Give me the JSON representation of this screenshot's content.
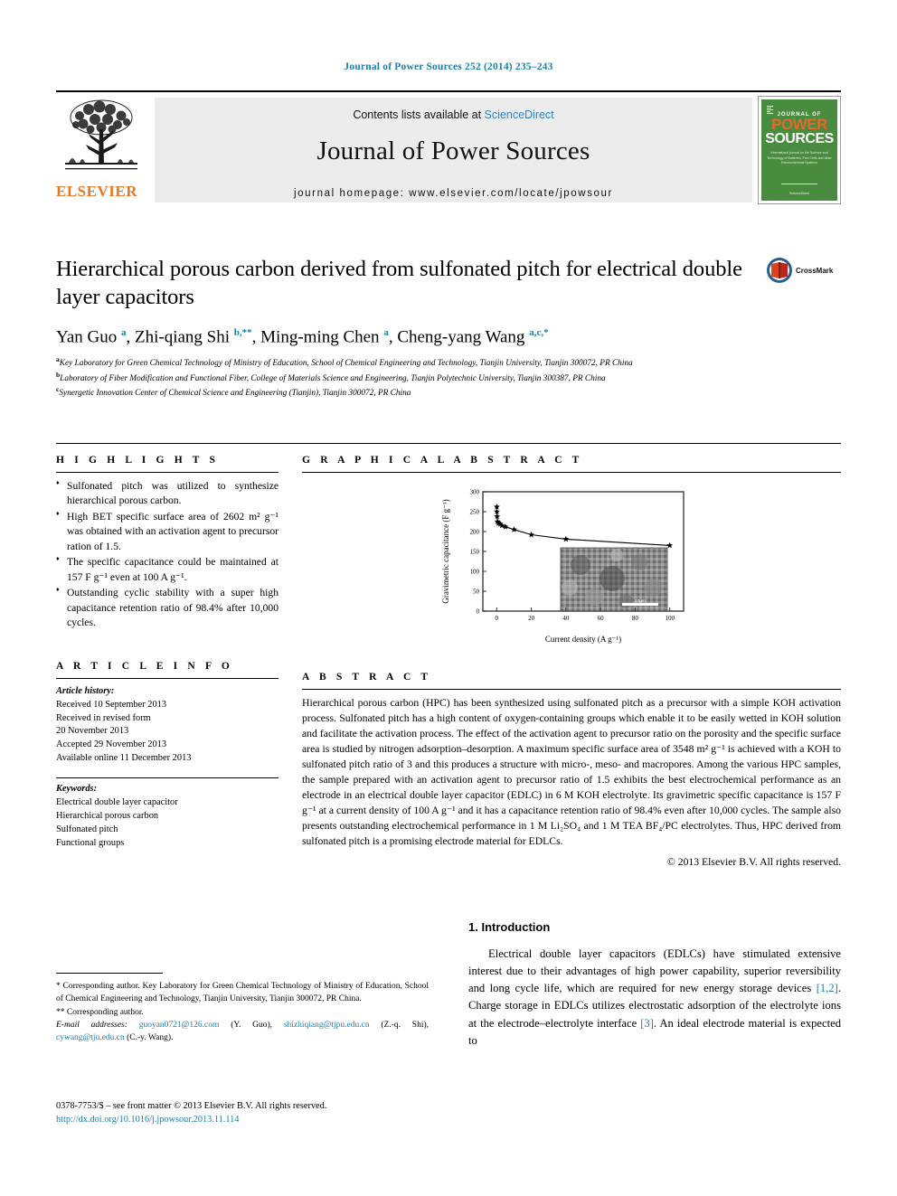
{
  "running_head": "Journal of Power Sources 252 (2014) 235–243",
  "masthead": {
    "publisher": "ELSEVIER",
    "contents_prefix": "Contents lists available at ",
    "sciencedirect": "ScienceDirect",
    "journal_title": "Journal of Power Sources",
    "homepage": "journal homepage: www.elsevier.com/locate/jpowsour",
    "cover": {
      "line1": "JOURNAL OF",
      "line2": "POWER",
      "line3": "SOURCES",
      "subtitle": "International journal on the Science and Technology of Batteries, Fuel Cells and other Electrochemical Systems",
      "footer": "ScienceDirect"
    }
  },
  "article": {
    "title": "Hierarchical porous carbon derived from sulfonated pitch for electrical double layer capacitors",
    "crossmark_label": "CrossMark",
    "authors_html": "Yan Guo <sup>a</sup>, Zhi-qiang Shi <sup>b,**</sup>, Ming-ming Chen <sup>a</sup>, Cheng-yang Wang <sup>a,c,*</sup>",
    "affiliations": [
      "Key Laboratory for Green Chemical Technology of Ministry of Education, School of Chemical Engineering and Technology, Tianjin University, Tianjin 300072, PR China",
      "Laboratory of Fiber Modification and Functional Fiber, College of Materials Science and Engineering, Tianjin Polytechnic University, Tianjin 300387, PR China",
      "Synergetic Innovation Center of Chemical Science and Engineering (Tianjin), Tianjin 300072, PR China"
    ],
    "affiliation_marks": [
      "a",
      "b",
      "c"
    ]
  },
  "highlights": {
    "heading": "H I G H L I G H T S",
    "items": [
      "Sulfonated pitch was utilized to synthesize hierarchical porous carbon.",
      "High BET specific surface area of 2602 m² g⁻¹ was obtained with an activation agent to precursor ration of 1.5.",
      "The specific capacitance could be maintained at 157 F g⁻¹ even at 100 A g⁻¹.",
      "Outstanding cyclic stability with a super high capacitance retention ratio of 98.4% after 10,000 cycles."
    ]
  },
  "graphical_abstract": {
    "heading": "G R A P H I C A L   A B S T R A C T"
  },
  "chart_data": {
    "type": "line",
    "title": "",
    "xlabel": "Current density (A g⁻¹)",
    "ylabel": "Gravimetric capacitance (F g⁻¹)",
    "xlim": [
      -8,
      108
    ],
    "ylim": [
      0,
      300
    ],
    "xticks": [
      0,
      20,
      40,
      60,
      80,
      100
    ],
    "yticks": [
      0,
      50,
      100,
      150,
      200,
      250,
      300
    ],
    "grid": false,
    "legend": "none",
    "marker": "star",
    "x": [
      0.05,
      0.1,
      0.2,
      0.5,
      1,
      2,
      3,
      5,
      10,
      20,
      40,
      100
    ],
    "y": [
      262,
      250,
      238,
      225,
      221,
      219,
      215,
      212,
      205,
      192,
      181,
      165
    ],
    "inset": "SEM micrograph of hierarchical porous carbon, scale bar 10 µm"
  },
  "article_info": {
    "heading": "A R T I C L E   I N F O",
    "history_label": "Article history:",
    "history": [
      "Received 10 September 2013",
      "Received in revised form",
      "20 November 2013",
      "Accepted 29 November 2013",
      "Available online 11 December 2013"
    ],
    "keywords_label": "Keywords:",
    "keywords": [
      "Electrical double layer capacitor",
      "Hierarchical porous carbon",
      "Sulfonated pitch",
      "Functional groups"
    ]
  },
  "abstract": {
    "heading": "A B S T R A C T",
    "text": "Hierarchical porous carbon (HPC) has been synthesized using sulfonated pitch as a precursor with a simple KOH activation process. Sulfonated pitch has a high content of oxygen-containing groups which enable it to be easily wetted in KOH solution and facilitate the activation process. The effect of the activation agent to precursor ratio on the porosity and the specific surface area is studied by nitrogen adsorption–desorption. A maximum specific surface area of 3548 m² g⁻¹ is achieved with a KOH to sulfonated pitch ratio of 3 and this produces a structure with micro-, meso- and macropores. Among the various HPC samples, the sample prepared with an activation agent to precursor ratio of 1.5 exhibits the best electrochemical performance as an electrode in an electrical double layer capacitor (EDLC) in 6 M KOH electrolyte. Its gravimetric specific capacitance is 157 F g⁻¹ at a current density of 100 A g⁻¹ and it has a capacitance retention ratio of 98.4% even after 10,000 cycles. The sample also presents outstanding electrochemical performance in 1 M Li₂SO₄ and 1 M TEA BF₄/PC electrolytes. Thus, HPC derived from sulfonated pitch is a promising electrode material for EDLCs.",
    "copyright": "© 2013 Elsevier B.V. All rights reserved."
  },
  "footnotes": {
    "corresponding_1": "* Corresponding author. Key Laboratory for Green Chemical Technology of Ministry of Education, School of Chemical Engineering and Technology, Tianjin University, Tianjin 300072, PR China.",
    "corresponding_2": "** Corresponding author.",
    "email_label": "E-mail addresses:",
    "emails": [
      {
        "address": "guoyan0721@126.com",
        "name": "(Y. Guo)"
      },
      {
        "address": "shizhiqiang@tjpu.edu.cn",
        "name": "(Z.-q. Shi)"
      },
      {
        "address": "cywang@tju.edu.cn",
        "name": "(C.-y. Wang)"
      }
    ]
  },
  "introduction": {
    "heading": "1. Introduction",
    "paragraph_part1": "Electrical double layer capacitors (EDLCs) have stimulated extensive interest due to their advantages of high power capability, superior reversibility and long cycle life, which are required for new energy storage devices ",
    "ref1": "[1,2]",
    "paragraph_part2": ". Charge storage in EDLCs utilizes electrostatic adsorption of the electrolyte ions at the electrode–electrolyte interface ",
    "ref2": "[3]",
    "paragraph_part3": ". An ideal electrode material is expected to"
  },
  "footer": {
    "issn_line": "0378-7753/$ – see front matter © 2013 Elsevier B.V. All rights reserved.",
    "doi": "http://dx.doi.org/10.1016/j.jpowsour.2013.11.114"
  },
  "colors": {
    "link": "#1b7fa8",
    "elsevier_orange": "#E87722",
    "cover_green": "#4a8c3f",
    "band_gray": "#ececec"
  }
}
